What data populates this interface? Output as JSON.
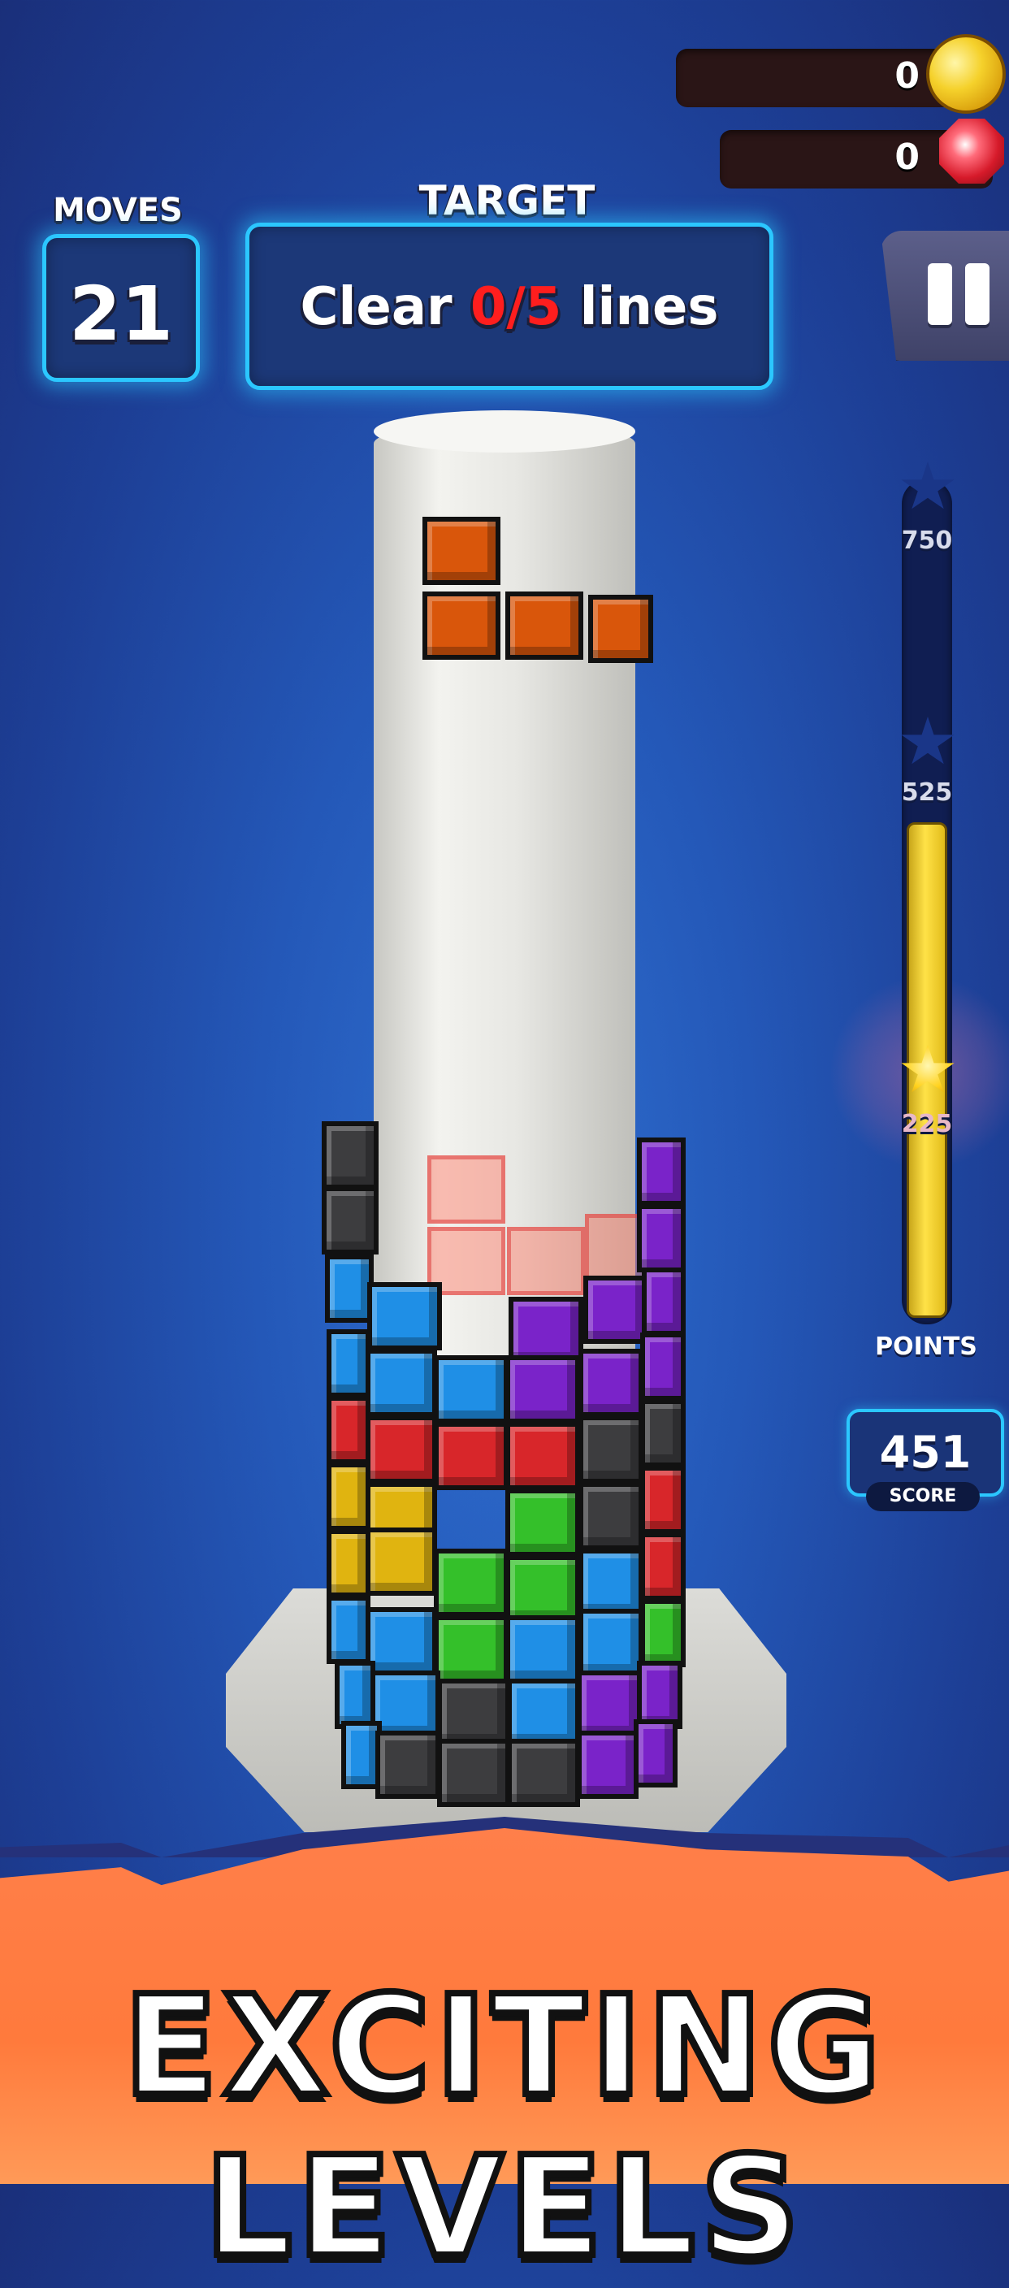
{
  "currency": {
    "coins": "0",
    "gems": "0",
    "coin_icon": "gold-coin-icon",
    "gem_icon": "red-gem-icon"
  },
  "moves": {
    "label": "MOVES",
    "value": "21"
  },
  "target": {
    "label": "TARGET",
    "prefix": "Clear ",
    "progress": "0/5",
    "suffix": " lines"
  },
  "pause": {
    "icon": "pause-icon"
  },
  "points": {
    "label": "POINTS",
    "milestones": [
      "750",
      "525",
      "225"
    ],
    "fill_fraction": 0.6
  },
  "score": {
    "value": "451",
    "label": "SCORE"
  },
  "banner": {
    "text": "EXCITING LEVELS"
  },
  "colors": {
    "background": "#2458b8",
    "panel_border": "#2bc7ff",
    "target_highlight": "#ff1e1e",
    "banner": "#ff7f4a",
    "bar_fill": "#ffe247"
  },
  "blocks": {
    "colors": {
      "orange": "#d9560b",
      "blue": "#1f8fe6",
      "purple": "#7a23c9",
      "red": "#d8262a",
      "green": "#34c02a",
      "yellow": "#e0b410",
      "gray": "#3d3d3f"
    }
  }
}
